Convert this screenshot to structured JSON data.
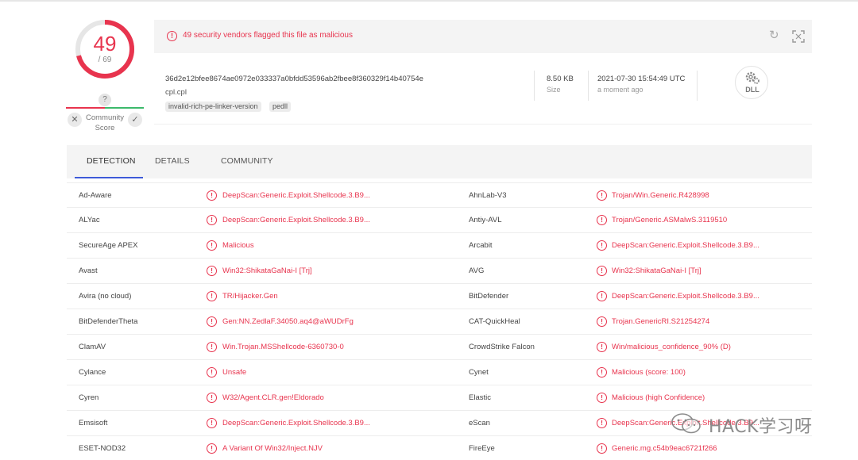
{
  "score": {
    "detected": "49",
    "total": "/ 69",
    "detected_fraction": 0.71,
    "color": "#e8344e"
  },
  "community": {
    "unknown_mark": "?",
    "label": "Community Score",
    "dismiss_icon": "close-icon",
    "confirm_icon": "check-icon"
  },
  "alert": {
    "icon": "alert-icon",
    "message": "49 security vendors flagged this file as malicious",
    "color": "#e8344e"
  },
  "file": {
    "hash": "36d2e12bfee8674ae0972e033337a0bfdd53596ab2fbee8f360329f14b40754e",
    "name": "cpl.cpl",
    "tags": [
      "invalid-rich-pe-linker-version",
      "pedll"
    ],
    "size_value": "8.50 KB",
    "size_label": "Size",
    "date_value": "2021-07-30 15:54:49 UTC",
    "date_label": "a moment ago",
    "type_badge": "DLL",
    "type_icon": "gear-icon"
  },
  "tabs": [
    {
      "label": "DETECTION",
      "active": true
    },
    {
      "label": "DETAILS",
      "active": false
    },
    {
      "label": "COMMUNITY",
      "active": false
    }
  ],
  "accent": "#3e5bd8",
  "detections": [
    {
      "left_vendor": "Ad-Aware",
      "left_result": "DeepScan:Generic.Exploit.Shellcode.3.B9...",
      "right_vendor": "AhnLab-V3",
      "right_result": "Trojan/Win.Generic.R428998"
    },
    {
      "left_vendor": "ALYac",
      "left_result": "DeepScan:Generic.Exploit.Shellcode.3.B9...",
      "right_vendor": "Antiy-AVL",
      "right_result": "Trojan/Generic.ASMalwS.3119510"
    },
    {
      "left_vendor": "SecureAge APEX",
      "left_result": "Malicious",
      "right_vendor": "Arcabit",
      "right_result": "DeepScan:Generic.Exploit.Shellcode.3.B9..."
    },
    {
      "left_vendor": "Avast",
      "left_result": "Win32:ShikataGaNai-I [Trj]",
      "right_vendor": "AVG",
      "right_result": "Win32:ShikataGaNai-I [Trj]"
    },
    {
      "left_vendor": "Avira (no cloud)",
      "left_result": "TR/Hijacker.Gen",
      "right_vendor": "BitDefender",
      "right_result": "DeepScan:Generic.Exploit.Shellcode.3.B9..."
    },
    {
      "left_vendor": "BitDefenderTheta",
      "left_result": "Gen:NN.ZedlaF.34050.aq4@aWUDrFg",
      "right_vendor": "CAT-QuickHeal",
      "right_result": "Trojan.GenericRI.S21254274"
    },
    {
      "left_vendor": "ClamAV",
      "left_result": "Win.Trojan.MSShellcode-6360730-0",
      "right_vendor": "CrowdStrike Falcon",
      "right_result": "Win/malicious_confidence_90% (D)"
    },
    {
      "left_vendor": "Cylance",
      "left_result": "Unsafe",
      "right_vendor": "Cynet",
      "right_result": "Malicious (score: 100)"
    },
    {
      "left_vendor": "Cyren",
      "left_result": "W32/Agent.CLR.gen!Eldorado",
      "right_vendor": "Elastic",
      "right_result": "Malicious (high Confidence)"
    },
    {
      "left_vendor": "Emsisoft",
      "left_result": "DeepScan:Generic.Exploit.Shellcode.3.B9...",
      "right_vendor": "eScan",
      "right_result": "DeepScan:Generic.Exploit.Shellcode.3.B9..."
    },
    {
      "left_vendor": "ESET-NOD32",
      "left_result": "A Variant Of Win32/Inject.NJV",
      "right_vendor": "FireEye",
      "right_result": "Generic.mg.c54b9eac6721f266"
    }
  ],
  "watermark": {
    "text": "HACK学习呀",
    "icon": "wechat-icon"
  }
}
